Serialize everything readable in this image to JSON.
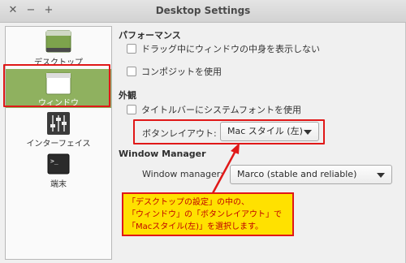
{
  "window": {
    "title": "Desktop Settings",
    "close_glyph": "✕",
    "minimize_glyph": "−",
    "maximize_glyph": "+"
  },
  "sidebar": {
    "items": [
      {
        "label": "デスクトップ",
        "icon": "desktop-icon"
      },
      {
        "label": "ウィンドウ",
        "icon": "window-icon",
        "selected": true
      },
      {
        "label": "インターフェイス",
        "icon": "sliders-icon"
      },
      {
        "label": "端末",
        "icon": "terminal-icon"
      }
    ],
    "selected_color": "#8fb15f"
  },
  "sections": {
    "performance": {
      "title": "パフォーマンス",
      "options": [
        {
          "label": "ドラッグ中にウィンドウの中身を表示しない",
          "checked": false
        },
        {
          "label": "コンポジットを使用",
          "checked": false
        }
      ]
    },
    "appearance": {
      "title": "外観",
      "options": [
        {
          "label": "タイトルバーにシステムフォントを使用",
          "checked": false
        }
      ],
      "button_layout_label": "ボタンレイアウト:",
      "button_layout_value": "Mac スタイル (左)"
    },
    "window_manager": {
      "title": "Window Manager",
      "label": "Window manager:",
      "value": "Marco (stable and reliable)"
    }
  },
  "callout": {
    "lines": [
      "「デスクトップの設定」の中の、",
      "「ウィンドウ」の「ボタンレイアウト」で",
      "「Macスタイル(左)」を選択します。"
    ]
  },
  "colors": {
    "highlight_red": "#e01818",
    "callout_bg": "#ffe100",
    "callout_text": "#c00000"
  }
}
